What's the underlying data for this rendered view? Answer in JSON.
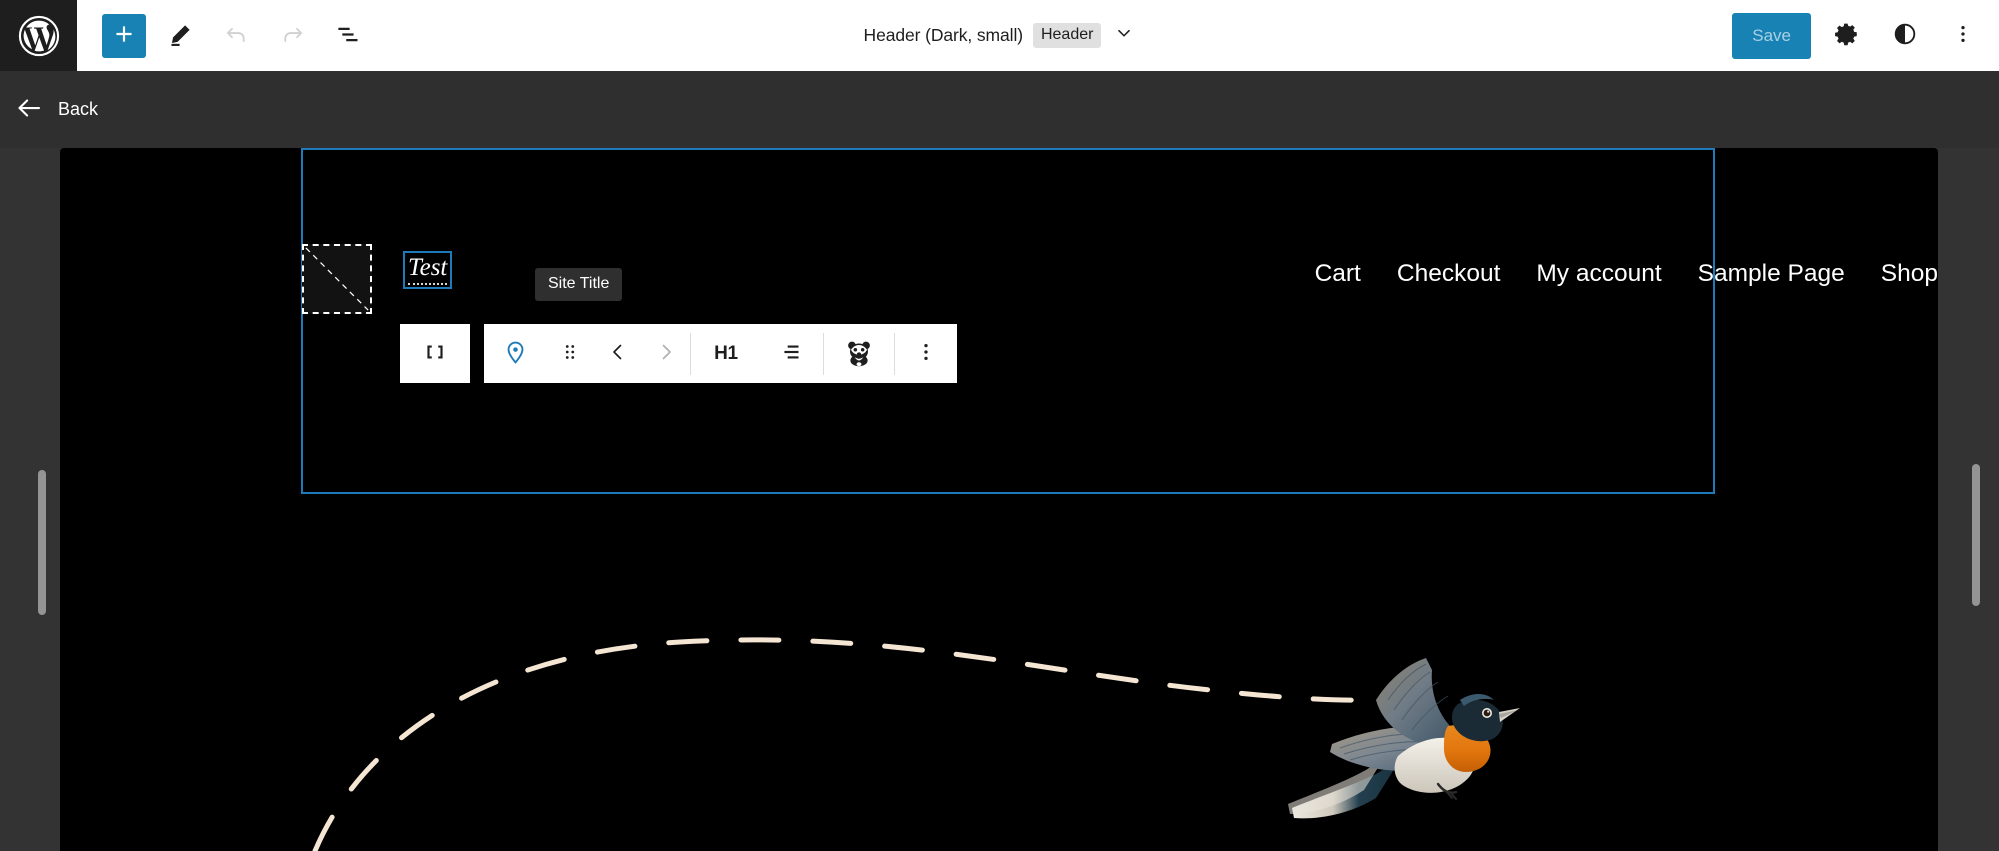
{
  "app": {
    "name": "WordPress Site Editor",
    "logo_icon": "wordpress-logo-icon",
    "canvas_background": "#000000",
    "accent_color": "#1982b4",
    "selection_color": "#1e7ab8",
    "chrome_background": "#333333"
  },
  "topbar": {
    "add_block_label": "+",
    "add_block_icon": "plus-icon",
    "tools_icon": "pencil-edit-icon",
    "undo_icon": "undo-arrow-icon",
    "redo_icon": "redo-arrow-icon",
    "list_view_icon": "list-view-icon",
    "document_title": "Header (Dark, small)",
    "document_badge": "Header",
    "document_chevron_icon": "chevron-down-icon",
    "save_label": "Save",
    "settings_icon": "gear-icon",
    "styles_icon": "contrast-half-circle-icon",
    "options_icon": "vertical-three-dots-icon"
  },
  "backbar": {
    "back_label": "Back",
    "back_icon": "arrow-left-icon"
  },
  "block_toolbar": {
    "parent_block": {
      "label": "Group",
      "icon": "group-brackets-icon"
    },
    "items": [
      {
        "name": "site-logo-placeholder-icon",
        "icon": "map-pin-icon",
        "label": ""
      },
      {
        "name": "drag-handle",
        "icon": "drag-dots-icon",
        "label": ""
      },
      {
        "name": "move-up",
        "icon": "chevron-left-icon",
        "label": ""
      },
      {
        "name": "move-down",
        "icon": "chevron-right-icon",
        "label": ""
      },
      {
        "name": "heading-level",
        "icon": "h1-text-icon",
        "label": "H1"
      },
      {
        "name": "text-align",
        "icon": "align-left-icon",
        "label": ""
      },
      {
        "name": "plugin-block",
        "icon": "panda-mascot-icon",
        "label": ""
      },
      {
        "name": "more-options",
        "icon": "vertical-three-dots-icon",
        "label": ""
      }
    ]
  },
  "canvas": {
    "template_part": {
      "name": "Header",
      "selected": true
    },
    "site_logo": {
      "placeholder_label": "",
      "icon": "image-placeholder-icon"
    },
    "site_title": {
      "value": "Test",
      "tooltip": "Site Title",
      "selected": true
    },
    "navigation": {
      "links": [
        {
          "label": "Cart"
        },
        {
          "label": "Checkout"
        },
        {
          "label": "My account"
        },
        {
          "label": "Sample Page"
        },
        {
          "label": "Shop"
        }
      ]
    },
    "artwork": {
      "bird_alt": "illustrated flying bird with orange throat",
      "curve_color": "#f5e6d3",
      "curve_style": "dashed"
    }
  },
  "scrollbars": {
    "left_thumb_visible": true,
    "right_thumb_visible": true
  }
}
